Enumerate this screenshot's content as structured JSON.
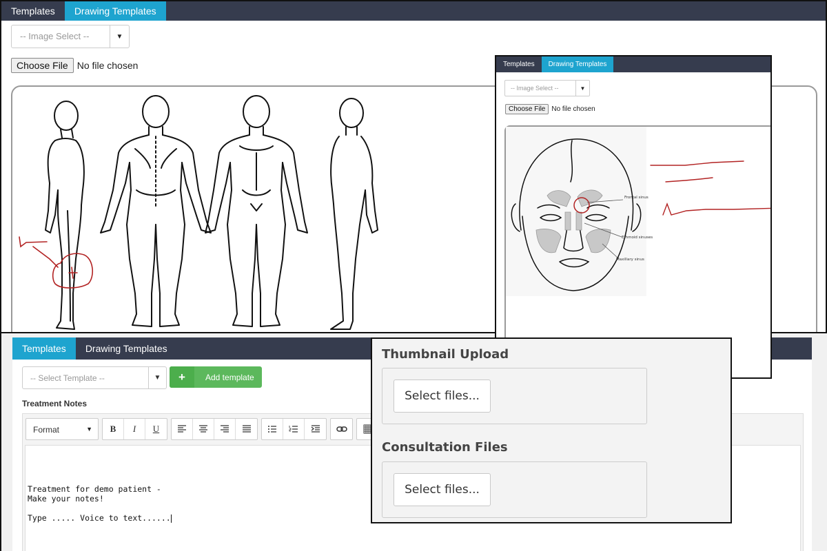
{
  "colors": {
    "tab_active": "#1ea4cf",
    "tabbar": "#363c4e",
    "drawing_ink": "#b22222",
    "add_button": "#5cb85c"
  },
  "panel_body_map": {
    "tabs": [
      "Templates",
      "Drawing Templates"
    ],
    "image_select_placeholder": "-- Image Select --",
    "choose_file_label": "Choose File",
    "no_file_text": "No file chosen"
  },
  "panel_face": {
    "tabs": [
      "Templates",
      "Drawing Templates"
    ],
    "image_select_placeholder": "-- Image Select --",
    "choose_file_label": "Choose File",
    "no_file_text": "No file chosen",
    "annotations": {
      "frontal": "Frontal sinus",
      "ethmoid": "Ethmoid sinuses",
      "maxillary": "Maxillary sinus"
    }
  },
  "panel_notes": {
    "tabs": [
      "Templates",
      "Drawing Templates"
    ],
    "template_select_placeholder": "-- Select Template --",
    "add_template_label": "Add template",
    "treatment_notes_label": "Treatment Notes",
    "format_label": "Format",
    "toolbar_icons": [
      "bold-icon",
      "italic-icon",
      "underline-icon",
      "align-left-icon",
      "align-center-icon",
      "align-right-icon",
      "justify-icon",
      "bullet-list-icon",
      "numbered-list-icon",
      "indent-icon",
      "link-icon",
      "table-icon"
    ],
    "note_lines": [
      "Treatment for demo patient -",
      "Make your notes!",
      "",
      "Type ..... Voice to text......"
    ]
  },
  "panel_uploads": {
    "thumbnail_title": "Thumbnail Upload",
    "thumbnail_button": "Select files...",
    "consultation_title": "Consultation Files",
    "consultation_button": "Select files..."
  }
}
